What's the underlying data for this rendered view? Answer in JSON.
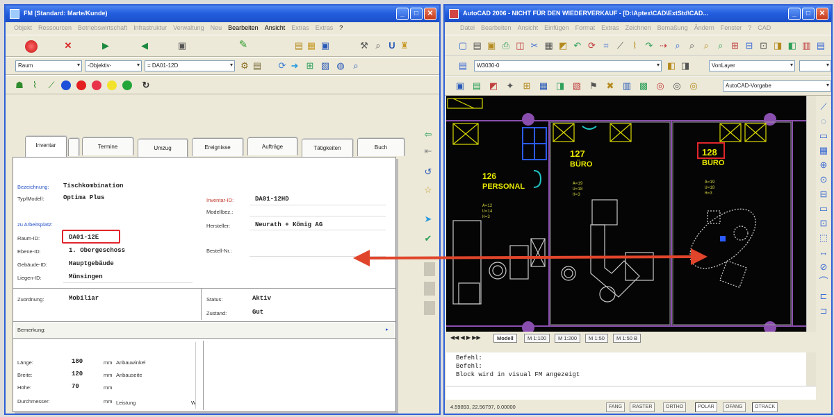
{
  "left_window": {
    "title": "FM (Standard: Marte/Kunde)",
    "menu": [
      "Objekt",
      "Ressourcen",
      "Betriebswirtschaft",
      "Infrastruktur",
      "Verwaltung",
      "Neu",
      "Bearbeiten",
      "Ansicht",
      "Extras",
      "Extras",
      "?"
    ],
    "menu_active": [
      6,
      7,
      10
    ],
    "filters": {
      "room": "Raum",
      "object": "-Objektiv-",
      "id": "= DA01-12D"
    },
    "tabs": [
      "Inventar",
      "",
      "Termine",
      "Umzug",
      "Ereignisse",
      "Aufträge",
      "Tätigkeiten",
      "Buch"
    ],
    "form": {
      "bezeichnung_label": "Bezeichnung:",
      "bezeichnung_value": "Tischkombination",
      "typ_label": "Typ/Modell:",
      "typ_value": "Optima Plus",
      "inventar_label": "Inventar-ID:",
      "inventar_value": "DA01-12HD",
      "modell_label": "Modellbez.:",
      "arbeitsplatz_label": "zu Arbeitsplatz:",
      "hersteller_label": "Hersteller:",
      "hersteller_value": "Neurath + König AG",
      "raum_label": "Raum-ID:",
      "raum_value": "DA01-12E",
      "bestell_label": "Bestell-Nr.:",
      "ebene_label": "Ebene-ID:",
      "ebene_value": "1. Obergeschoss",
      "gebaeude_label": "Gebäude-ID:",
      "gebaeude_value": "Hauptgebäude",
      "liegen_label": "Liegen-ID:",
      "liegen_value": "Münsingen",
      "zuordnung_label": "Zuordnung:",
      "zuordnung_value": "Mobiliar",
      "status_label": "Status:",
      "status_value": "Aktiv",
      "zustand_label": "Zustand:",
      "zustand_value": "Gut",
      "bemerkung_label": "Bemerkung:",
      "laenge_label": "Länge:",
      "laenge_value": "180",
      "laenge_unit": "mm",
      "anbau_winkel": "Anbauwinkel",
      "breite_label": "Breite:",
      "breite_value": "120",
      "breite_unit": "mm",
      "anbau_seite": "Anbauseite",
      "hoehe_label": "Höhe:",
      "hoehe_value": "70",
      "hoehe_unit": "mm",
      "durchmesser_label": "Durchmesser:",
      "durchmesser_unit": "mm",
      "leistung_label": "Leistung",
      "leistung_unit": "W"
    }
  },
  "right_window": {
    "title": "AutoCAD 2006 - NICHT FÜR DEN WIEDERVERKAUF - [D:\\Aptex\\CAD\\ExtStd\\CAD...",
    "menu": [
      "Datei",
      "Bearbeiten",
      "Ansicht",
      "Einfügen",
      "Format",
      "Extras",
      "Zeichnen",
      "Bemaßung",
      "Ändern",
      "Fenster",
      "?",
      "CAD"
    ],
    "layer_combo": "W3030-0",
    "layer_combo2": "VonLayer",
    "style_combo": "AutoCAD-Vorgabe",
    "rooms": [
      {
        "number": "126",
        "name": "PERSONAL"
      },
      {
        "number": "127",
        "name": "BÜRO"
      },
      {
        "number": "128",
        "name": "BÜRO"
      }
    ],
    "layout_tabs": [
      "Modell",
      "M 1:100",
      "M 1:200",
      "M 1:50",
      "M 1:50 B"
    ],
    "command_lines": [
      "Befehl:",
      "Befehl:",
      "Block wird in visual FM angezeigt"
    ],
    "coords": "4.59893, 22.56797, 0.00000",
    "status_buttons": [
      "FANG",
      "RASTER",
      "ORTHO",
      "POLAR",
      "OFANG",
      "OTRACK"
    ],
    "status_on": [
      3,
      5
    ]
  },
  "colors": {
    "titlebar": "#245fe0",
    "cad_background": "#050505",
    "highlight_red": "#e0262b",
    "arrow_red": "#e0452b",
    "cad_yellow": "#d8d800",
    "cad_purple": "#8a4fae",
    "label_blue": "#2a54c8"
  }
}
